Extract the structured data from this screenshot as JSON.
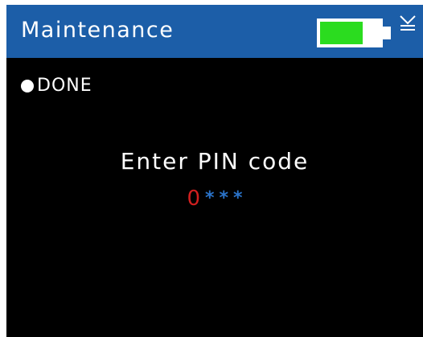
{
  "header": {
    "title": "Maintenance",
    "battery_level": 0.72,
    "battery_color": "#2bdc1f",
    "header_color": "#1c5ea8",
    "signal_icon": "signal-icon"
  },
  "status": {
    "indicator_icon": "dot-icon",
    "label": "DONE"
  },
  "pin_entry": {
    "prompt": "Enter PIN code",
    "active_digit": "0",
    "masked_digits": [
      "*",
      "*",
      "*"
    ],
    "active_color": "#d11f1f",
    "masked_color": "#2a73c9"
  }
}
